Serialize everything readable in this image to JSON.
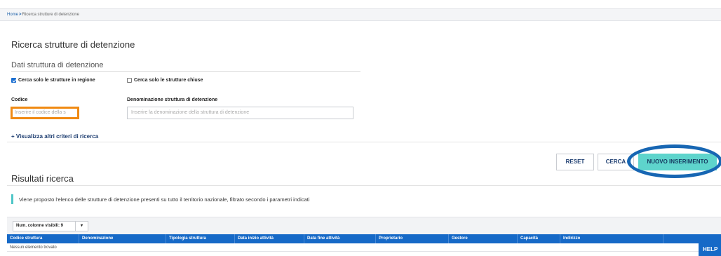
{
  "breadcrumb": {
    "home": "Home",
    "separator": ">",
    "current": "Ricerca strutture di detenzione"
  },
  "page_title": "Ricerca strutture di detenzione",
  "search_form": {
    "section_title": "Dati struttura di detenzione",
    "checkbox_region": {
      "label": "Cerca solo le strutture in regione",
      "checked": true
    },
    "checkbox_closed": {
      "label": "Cerca solo le strutture chiuse",
      "checked": false
    },
    "codice": {
      "label": "Codice",
      "placeholder": "Inserire il codice della s"
    },
    "denominazione": {
      "label": "Denominazione struttura di detenzione",
      "placeholder": "Inserire la denominazione della struttura di detenzione"
    },
    "more_criteria": "+ Visualizza altri criteri di ricerca"
  },
  "actions": {
    "reset": "RESET",
    "search": "CERCA",
    "new_entry": "NUOVO INSERIMENTO"
  },
  "results": {
    "title": "Risultati ricerca",
    "info": "Viene proposto l'elenco delle strutture di detenzione presenti su tutto il territorio nazionale, filtrato secondo i parametri indicati",
    "visible_columns": "Num. colonne visibili: 9",
    "columns": [
      "Codice struttura",
      "Denominazione",
      "Tipologia struttura",
      "Data inizio attività",
      "Data fine attività",
      "Proprietario",
      "Gestore",
      "Capacità",
      "Indirizzo",
      ""
    ],
    "empty_message": "Nessun elemento trovato"
  },
  "help_label": "HELP",
  "colors": {
    "accent": "#1669c7",
    "primary_button": "#5ed4cc",
    "focus": "#f08a13",
    "highlight_ring": "#1766b3",
    "link": "#1d3d70"
  }
}
